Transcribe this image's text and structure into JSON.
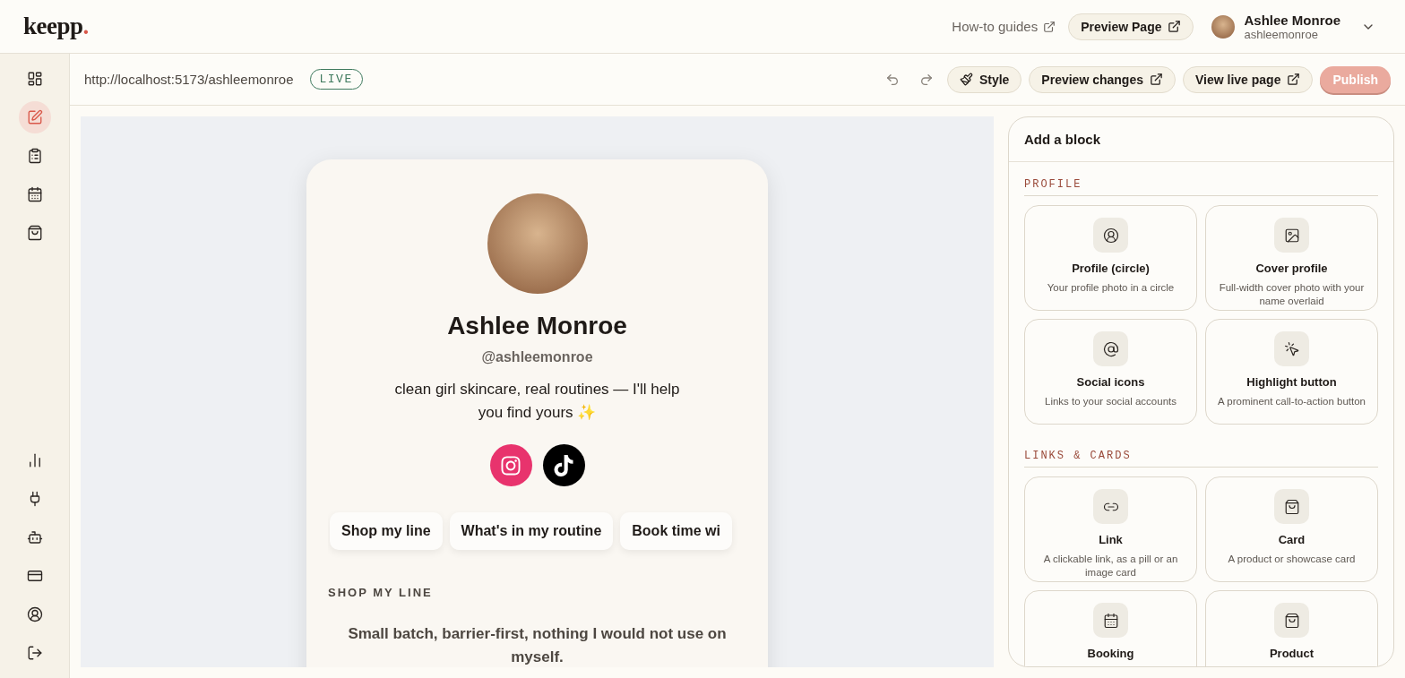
{
  "logo": {
    "text": "keepp",
    "mark": "."
  },
  "header": {
    "guides_link": "How-to guides",
    "preview_button": "Preview Page",
    "user": {
      "name": "Ashlee Monroe",
      "handle": "ashleemonroe"
    }
  },
  "sidebar": {
    "items": [
      {
        "selected": false
      },
      {
        "selected": true
      },
      {
        "selected": false
      },
      {
        "selected": false
      },
      {
        "selected": false
      }
    ],
    "bottom_items": [
      {
        "selected": false
      },
      {
        "selected": false
      },
      {
        "selected": false
      },
      {
        "selected": false
      },
      {
        "selected": false
      },
      {
        "selected": false
      }
    ]
  },
  "toolbar": {
    "url": "http://localhost:5173/ashleemonroe",
    "status": "LIVE",
    "buttons": [
      {
        "label": "Style",
        "kind": "style"
      },
      {
        "label": "Preview changes",
        "kind": "external"
      },
      {
        "label": "View live page",
        "kind": "external"
      }
    ],
    "publish": {
      "label": "Publish",
      "disabled": true
    }
  },
  "preview": {
    "name": "Ashlee Monroe",
    "handle": "@ashleemonroe",
    "bio": "clean girl skincare, real routines — I'll help you find yours ✨",
    "socials": [
      {
        "kind": "instagram",
        "color": "#e8336d"
      },
      {
        "kind": "tiktok",
        "color": "#000000"
      }
    ],
    "links": [
      "Shop my line",
      "What's in my routine",
      "Book time wi"
    ],
    "section": {
      "title": "SHOP MY LINE",
      "text": "Small batch, barrier-first, nothing I would not use on myself."
    }
  },
  "panel": {
    "title": "Add a block",
    "groups": [
      {
        "title": "PROFILE",
        "blocks": [
          {
            "kind": "profile",
            "title": "Profile (circle)",
            "description": "Your profile photo in a circle"
          },
          {
            "kind": "cover",
            "title": "Cover profile",
            "description": "Full-width cover photo with your name overlaid"
          },
          {
            "kind": "social",
            "title": "Social icons",
            "description": "Links to your social accounts"
          },
          {
            "kind": "highlight",
            "title": "Highlight button",
            "description": "A prominent call-to-action button"
          }
        ]
      },
      {
        "title": "LINKS & CARDS",
        "blocks": [
          {
            "kind": "link",
            "title": "Link",
            "description": "A clickable link, as a pill or an image card"
          },
          {
            "kind": "card",
            "title": "Card",
            "description": "A product or showcase card"
          },
          {
            "kind": "booking",
            "title": "Booking"
          },
          {
            "kind": "product",
            "title": "Product"
          }
        ]
      }
    ]
  }
}
